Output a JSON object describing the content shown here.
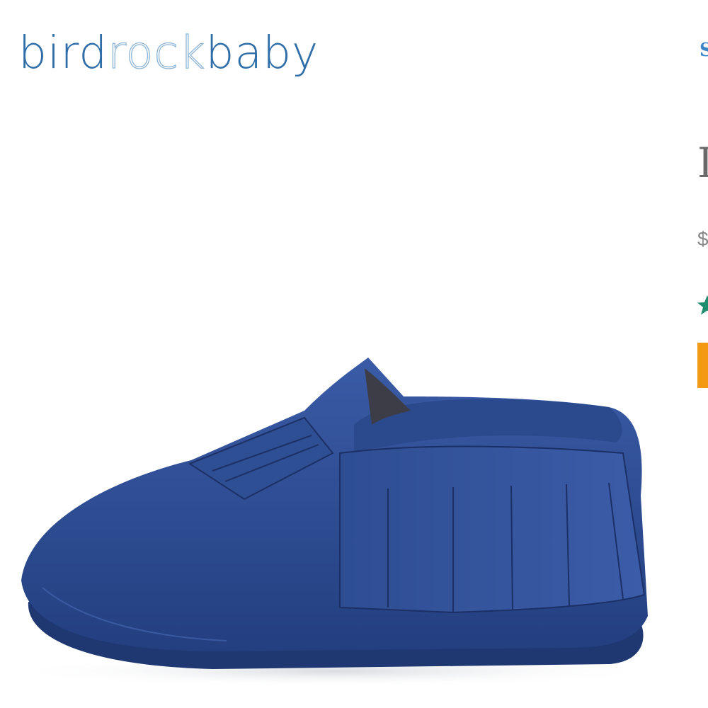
{
  "brand": {
    "logo_parts": [
      "bird",
      "rock",
      "baby"
    ]
  },
  "header": {
    "nav_partial": "S"
  },
  "product": {
    "title_partial": "I",
    "price_partial": "$",
    "rating_icon": "star-icon",
    "cta_icon": "add-to-cart-button",
    "colors": {
      "brand_blue": "#2f6ea8",
      "shoe_blue": "#2c4a8e",
      "rating_star": "#1f8c6e",
      "cta_orange": "#f39914"
    }
  }
}
